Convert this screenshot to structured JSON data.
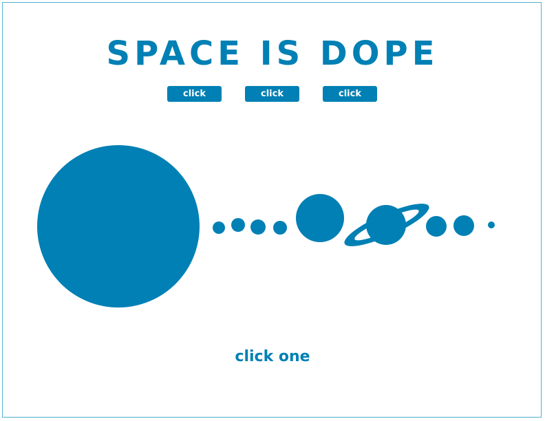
{
  "header": {
    "title": "SPACE IS DOPE"
  },
  "buttons": [
    {
      "label": "click"
    },
    {
      "label": "click"
    },
    {
      "label": "click"
    }
  ],
  "solar_system": {
    "bodies": [
      "sun",
      "mercury",
      "venus",
      "earth",
      "mars",
      "jupiter",
      "saturn",
      "uranus",
      "neptune",
      "pluto"
    ]
  },
  "footer": {
    "hint": "click one"
  },
  "colors": {
    "accent": "#0080b4",
    "border": "#4fb0d0",
    "background": "#ffffff"
  }
}
